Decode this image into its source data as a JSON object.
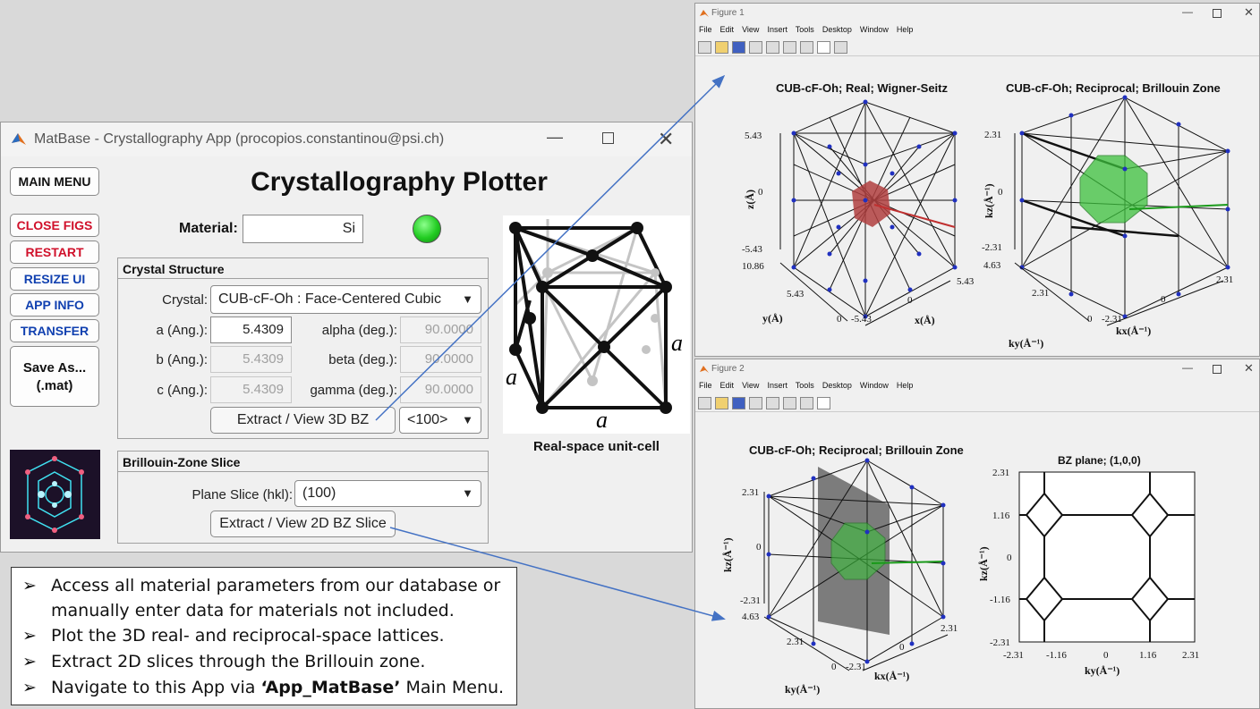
{
  "app": {
    "window_title": "MatBase - Crystallography App (procopios.constantinou@psi.ch)",
    "heading": "Crystallography Plotter",
    "sidebar": {
      "main_menu": "MAIN MENU",
      "close_figs": "CLOSE FIGS",
      "restart": "RESTART",
      "resize_ui": "RESIZE UI",
      "app_info": "APP INFO",
      "transfer": "TRANSFER",
      "save_as_line1": "Save As...",
      "save_as_line2": "(.mat)"
    },
    "material": {
      "label": "Material:",
      "value": "Si",
      "status_color": "#22cc22"
    },
    "crystal_structure": {
      "title": "Crystal Structure",
      "crystal_label": "Crystal:",
      "crystal_value": "CUB-cF-Oh : Face-Centered Cubic",
      "a_label": "a (Ang.):",
      "a_value": "5.4309",
      "b_label": "b (Ang.):",
      "b_value": "5.4309",
      "c_label": "c (Ang.):",
      "c_value": "5.4309",
      "alpha_label": "alpha (deg.):",
      "alpha_value": "90.0000",
      "beta_label": "beta (deg.):",
      "beta_value": "90.0000",
      "gamma_label": "gamma (deg.):",
      "gamma_value": "90.0000",
      "extract_3d_button": "Extract / View 3D BZ",
      "direction_value": "<100>"
    },
    "bz_slice": {
      "title": "Brillouin-Zone Slice",
      "plane_label": "Plane Slice (hkl):",
      "plane_value": "(100)",
      "extract_2d_button": "Extract / View 2D BZ Slice"
    },
    "unit_cell": {
      "caption": "Real-space unit-cell",
      "edge_label": "a"
    }
  },
  "figure1": {
    "title": "Figure 1",
    "menu": [
      "File",
      "Edit",
      "View",
      "Insert",
      "Tools",
      "Desktop",
      "Window",
      "Help"
    ],
    "left_plot": {
      "title": "CUB-cF-Oh; Real; Wigner-Seitz",
      "z_ticks": [
        "5.43",
        "0",
        "-5.43"
      ],
      "y_ticks": [
        "10.86",
        "5.43",
        "0"
      ],
      "x_ticks": [
        "-5.43",
        "0",
        "5.43"
      ],
      "zlabel": "z(Å)",
      "ylabel": "y(Å)",
      "xlabel": "x(Å)"
    },
    "right_plot": {
      "title": "CUB-cF-Oh; Reciprocal; Brillouin Zone",
      "z_ticks": [
        "2.31",
        "0",
        "-2.31"
      ],
      "y_ticks": [
        "4.63",
        "2.31",
        "0"
      ],
      "x_ticks": [
        "-2.31",
        "0",
        "2.31"
      ],
      "zlabel": "kz(Å⁻¹)",
      "ylabel": "ky(Å⁻¹)",
      "xlabel": "kx(Å⁻¹)"
    }
  },
  "figure2": {
    "title": "Figure 2",
    "menu": [
      "File",
      "Edit",
      "View",
      "Insert",
      "Tools",
      "Desktop",
      "Window",
      "Help"
    ],
    "left_plot": {
      "title": "CUB-cF-Oh; Reciprocal; Brillouin Zone",
      "z_ticks": [
        "2.31",
        "0",
        "-2.31"
      ],
      "y_ticks": [
        "4.63",
        "2.31",
        "0"
      ],
      "x_ticks": [
        "-2.31",
        "0",
        "2.31"
      ],
      "zlabel": "kz(Å⁻¹)",
      "ylabel": "ky(Å⁻¹)",
      "xlabel": "kx(Å⁻¹)"
    },
    "right_plot": {
      "title": "BZ plane; (1,0,0)",
      "y_ticks": [
        "2.31",
        "1.16",
        "0",
        "-1.16",
        "-2.31"
      ],
      "x_ticks": [
        "-2.31",
        "-1.16",
        "0",
        "1.16",
        "2.31"
      ],
      "ylabel": "kz(Å⁻¹)",
      "xlabel": "ky(Å⁻¹)"
    }
  },
  "bullets": {
    "marker": "➢",
    "items": [
      "Access all material parameters from our database or manually enter data for materials not included.",
      "Plot the 3D real- and reciprocal-space lattices.",
      "Extract 2D slices through the Brillouin zone."
    ],
    "last_prefix": "Navigate to this App via ",
    "last_bold": "‘App_MatBase’",
    "last_suffix": " Main Menu."
  }
}
